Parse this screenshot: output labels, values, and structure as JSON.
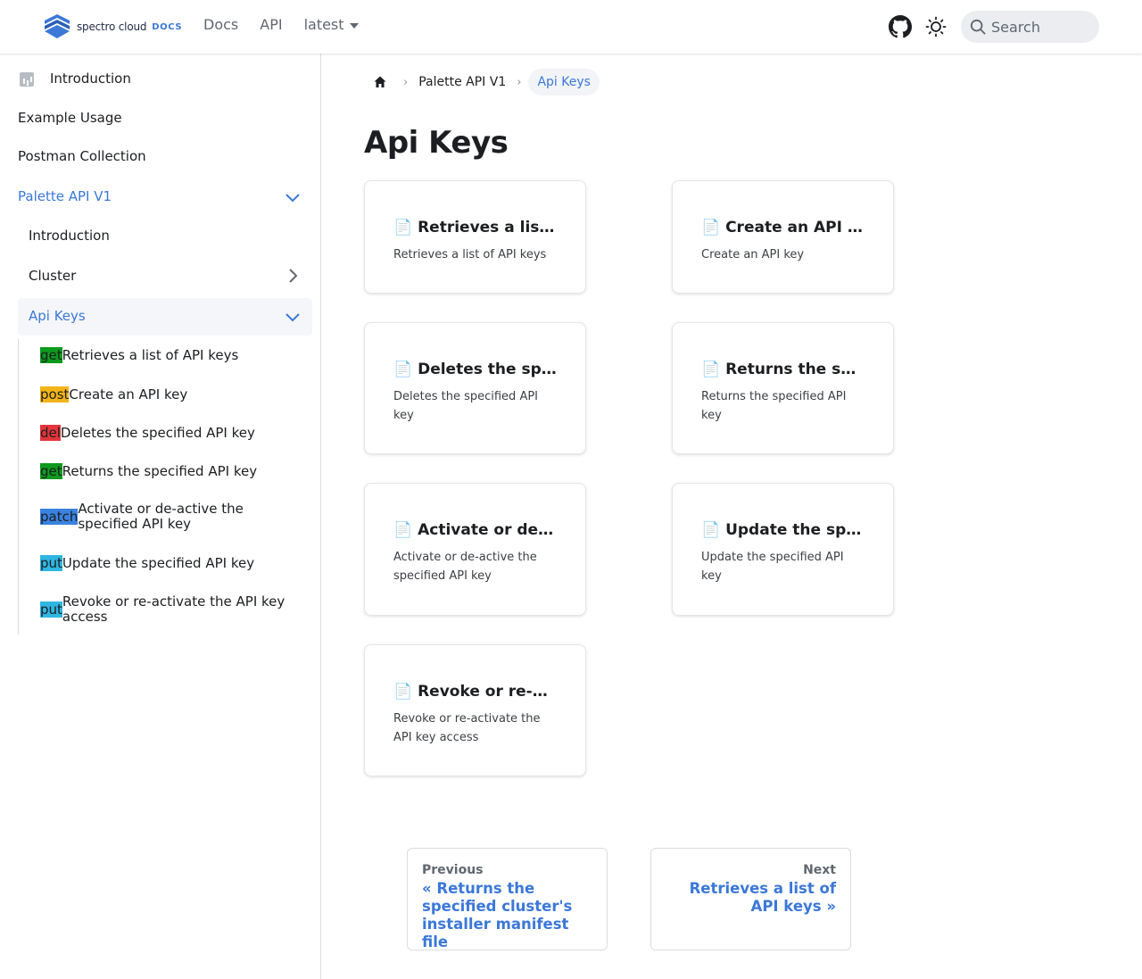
{
  "navbar": {
    "logo_text": "spectro cloud",
    "logo_badge": "DOCS",
    "links": [
      "Docs",
      "API"
    ],
    "version": "latest",
    "search_placeholder": "Search"
  },
  "sidebar": {
    "top_items": [
      "Introduction",
      "Example Usage",
      "Postman Collection"
    ],
    "section": "Palette API V1",
    "section_items": [
      "Introduction",
      "Cluster"
    ],
    "active_group": "Api Keys",
    "endpoints": [
      {
        "method": "get",
        "label": "Retrieves a list of API keys"
      },
      {
        "method": "post",
        "label": "Create an API key"
      },
      {
        "method": "del",
        "label": "Deletes the specified API key"
      },
      {
        "method": "get",
        "label": "Returns the specified API key"
      },
      {
        "method": "patch",
        "label": "Activate or de-active the specified API key"
      },
      {
        "method": "put",
        "label": "Update the specified API key"
      },
      {
        "method": "put",
        "label": "Revoke or re-activate the API key access"
      }
    ]
  },
  "breadcrumb": {
    "items": [
      "Palette API V1"
    ],
    "current": "Api Keys"
  },
  "page": {
    "title": "Api Keys",
    "cards": [
      {
        "title": "📄️ Retrieves a list of API keys",
        "desc": "Retrieves a list of API keys"
      },
      {
        "title": "📄️ Create an API key",
        "desc": "Create an API key"
      },
      {
        "title": "📄️ Deletes the specified API key",
        "desc": "Deletes the specified API key"
      },
      {
        "title": "📄️ Returns the specified API key",
        "desc": "Returns the specified API key"
      },
      {
        "title": "📄️ Activate or de-active the specified API key",
        "desc": "Activate or de-active the specified API key"
      },
      {
        "title": "📄️ Update the specified API key",
        "desc": "Update the specified API key"
      },
      {
        "title": "📄️ Revoke or re-activate the API key access",
        "desc": "Revoke or re-activate the API key access"
      }
    ]
  },
  "pagination": {
    "prev_sub": "Previous",
    "prev_label": "« Returns the specified cluster's installer manifest file",
    "next_sub": "Next",
    "next_label": "Retrieves a list of API keys »"
  },
  "colors": {
    "accent": "#3b78d8",
    "get": "#0b9a1d",
    "post": "#f2b418",
    "del": "#e3353a",
    "patch": "#3b82e0",
    "put": "#2fb6e2"
  }
}
